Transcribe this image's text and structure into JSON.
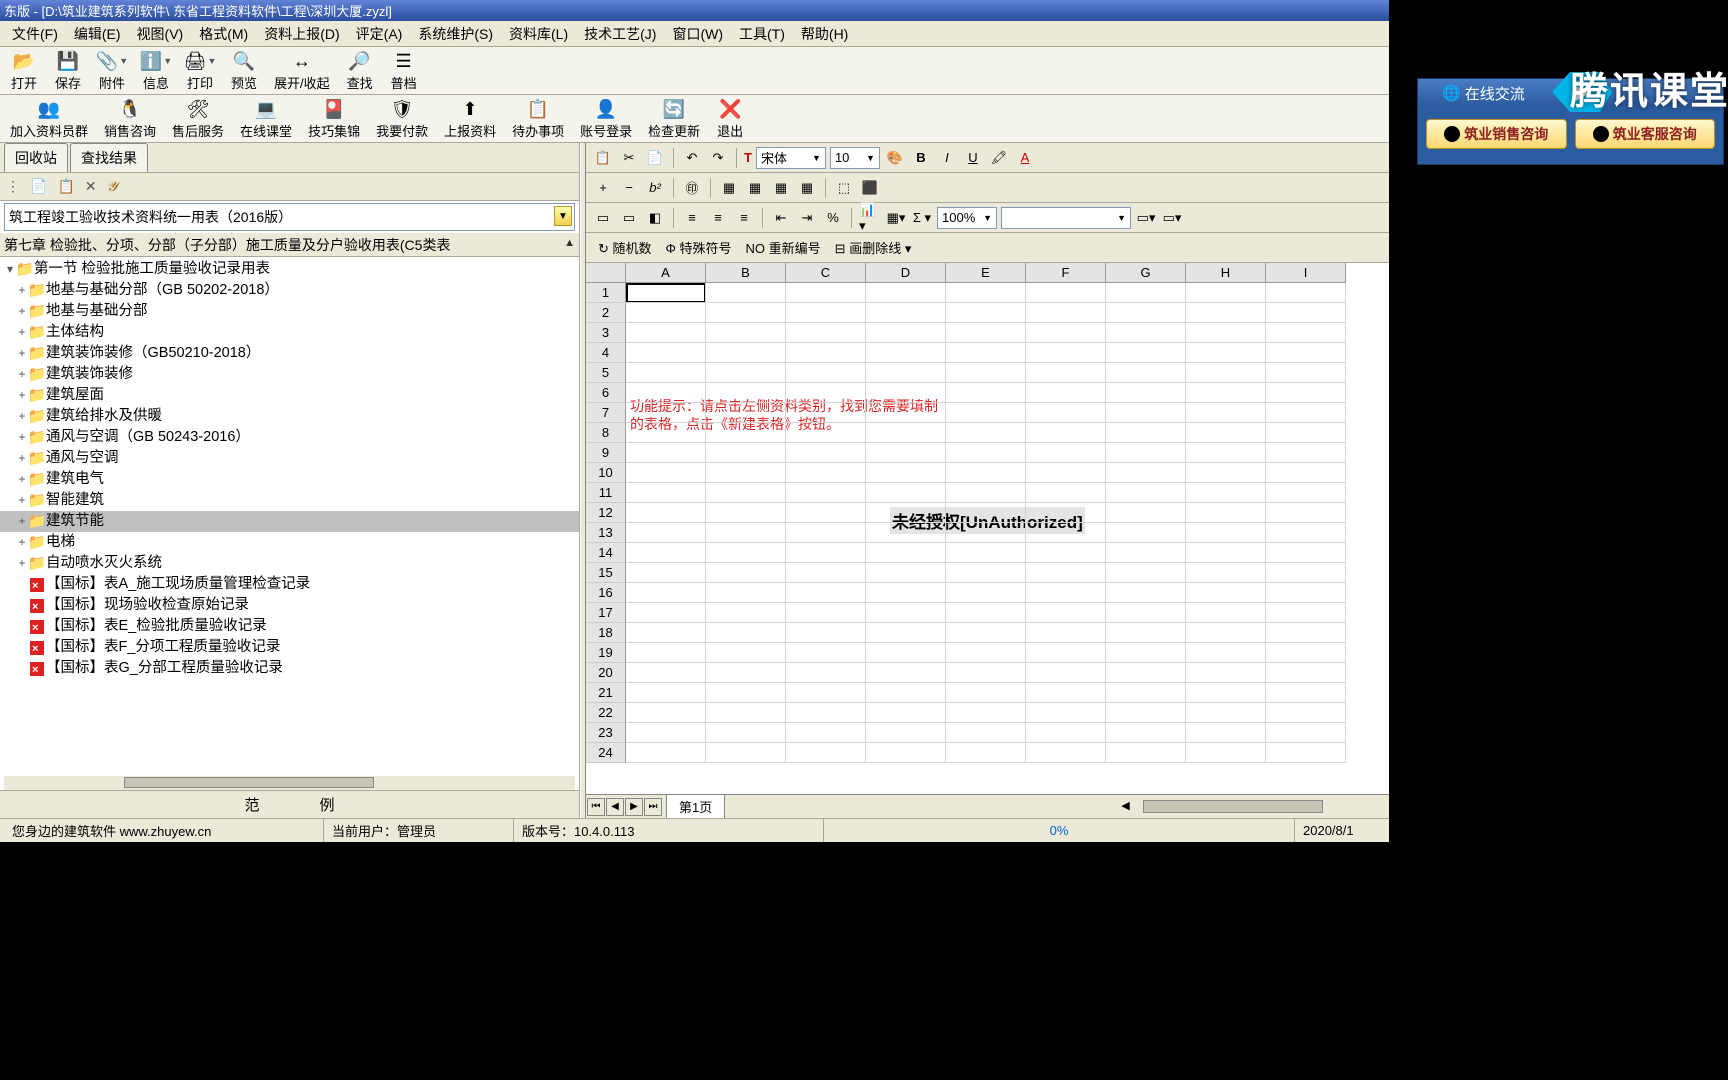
{
  "title": "东版 - [D:\\筑业建筑系列软件\\ 东省工程资料软件\\工程\\深圳大厦.zyzl]",
  "menu": [
    "文件(F)",
    "编辑(E)",
    "视图(V)",
    "格式(M)",
    "资料上报(D)",
    "评定(A)",
    "系统维护(S)",
    "资料库(L)",
    "技术工艺(J)",
    "窗口(W)",
    "工具(T)",
    "帮助(H)"
  ],
  "toolbar1": [
    {
      "ico": "📂",
      "label": "打开"
    },
    {
      "ico": "💾",
      "label": "保存"
    },
    {
      "ico": "📎",
      "label": "附件",
      "drop": true
    },
    {
      "ico": "ℹ️",
      "label": "信息",
      "drop": true
    },
    {
      "ico": "🖨",
      "label": "打印",
      "drop": true
    },
    {
      "ico": "🔍",
      "label": "预览"
    },
    {
      "ico": "↔",
      "label": "展开/收起"
    },
    {
      "ico": "🔎",
      "label": "查找"
    },
    {
      "ico": "☰",
      "label": "普档"
    }
  ],
  "toolbar2": [
    {
      "ico": "👥",
      "label": "加入资料员群"
    },
    {
      "ico": "🐧",
      "label": "销售咨询"
    },
    {
      "ico": "🛠",
      "label": "售后服务"
    },
    {
      "ico": "💻",
      "label": "在线课堂"
    },
    {
      "ico": "🎴",
      "label": "技巧集锦"
    },
    {
      "ico": "🛡",
      "label": "我要付款"
    },
    {
      "ico": "⬆",
      "label": "上报资料"
    },
    {
      "ico": "📋",
      "label": "待办事项"
    },
    {
      "ico": "👤",
      "label": "账号登录"
    },
    {
      "ico": "🔄",
      "label": "检查更新"
    },
    {
      "ico": "❌",
      "label": "退出"
    }
  ],
  "online": {
    "title": "在线交流",
    "btn1": "筑业销售咨询",
    "btn2": "筑业客服咨询"
  },
  "tencent": "腾讯课堂",
  "left": {
    "tabs": [
      "回收站",
      "查找结果"
    ],
    "combo": "筑工程竣工验收技术资料统一用表（2016版）",
    "section": "第七章 检验批、分项、分部（子分部）施工质量及分户验收用表(C5类表",
    "header_node": "第一节 检验批施工质量验收记录用表",
    "folders": [
      "地基与基础分部（GB 50202-2018）",
      "地基与基础分部",
      "主体结构",
      "建筑装饰装修（GB50210-2018）",
      "建筑装饰装修",
      "建筑屋面",
      "建筑给排水及供暖",
      "通风与空调（GB 50243-2016）",
      "通风与空调",
      "建筑电气",
      "智能建筑",
      "建筑节能",
      "电梯",
      "自动喷水灭火系统"
    ],
    "selected_index": 11,
    "files": [
      "【国标】表A_施工现场质量管理检查记录",
      "【国标】现场验收检查原始记录",
      "【国标】表E_检验批质量验收记录",
      "【国标】表F_分项工程质量验收记录",
      "【国标】表G_分部工程质量验收记录"
    ],
    "bottom_tabs": [
      "范",
      "例"
    ]
  },
  "sheet": {
    "font": "宋体",
    "size": "10",
    "zoom": "100%",
    "btns2": [
      "随机数",
      "特殊符号",
      "重新编号",
      "画删除线"
    ],
    "cols": [
      "A",
      "B",
      "C",
      "D",
      "E",
      "F",
      "G",
      "H",
      "I"
    ],
    "rows": 24,
    "hint": "功能提示：请点击左侧资料类别，找到您需要填制的表格，点击《新建表格》按钮。",
    "unauth": "未经授权[UnAuthorized]",
    "tab_name": "第1页"
  },
  "status": {
    "s1": "您身边的建筑软件  www.zhuyew.cn",
    "s2": "当前用户：管理员",
    "s3": "版本号：10.4.0.113",
    "pct": "0%",
    "date": "2020/8/1"
  }
}
